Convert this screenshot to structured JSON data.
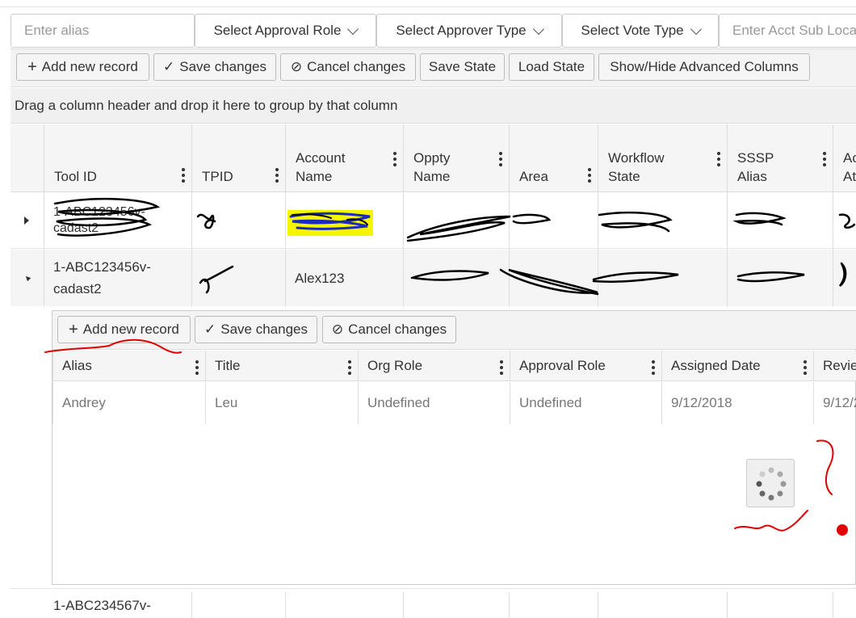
{
  "filters": {
    "alias_placeholder": "Enter alias",
    "approval_role": "Select Approval Role",
    "approver_type": "Select Approver Type",
    "vote_type": "Select Vote Type",
    "acct_sub_placeholder": "Enter Acct Sub Loca"
  },
  "toolbar": {
    "add": "Add new record",
    "save": "Save changes",
    "cancel": "Cancel changes",
    "save_state": "Save State",
    "load_state": "Load State",
    "toggle_columns": "Show/Hide Advanced Columns"
  },
  "grouping_hint": "Drag a column header and drop it here to group by that column",
  "columns": [
    "Tool ID",
    "TPID",
    "Account Name",
    "Oppty Name",
    "Area",
    "Workflow State",
    "SSSP Alias",
    "Ac At"
  ],
  "rows": [
    {
      "tool_id": "1-ABC123456v-cadast2",
      "tpid": "",
      "account_name": "",
      "oppty_name": "",
      "area": "",
      "workflow_state": "",
      "sssp_alias": ""
    },
    {
      "tool_id": "1-ABC123456v-cadast2",
      "tpid": "",
      "account_name": "Alex123",
      "oppty_name": "",
      "area": "",
      "workflow_state": "",
      "sssp_alias": ""
    },
    {
      "tool_id": "1-ABC234567v-"
    }
  ],
  "detail": {
    "toolbar": {
      "add": "Add new record",
      "save": "Save changes",
      "cancel": "Cancel changes"
    },
    "columns": [
      "Alias",
      "Title",
      "Org Role",
      "Approval Role",
      "Assigned Date",
      "Revie"
    ],
    "rows": [
      {
        "alias": "Andrey",
        "title": "Leu",
        "org_role": "Undefined",
        "approval_role": "Undefined",
        "assigned_date": "9/12/2018",
        "review": "9/12/2"
      }
    ]
  },
  "colors": {
    "highlight": "#f5f500",
    "annotation": "#e00000",
    "scribble": "#000000",
    "scribble_blue": "#1a2bbd"
  }
}
